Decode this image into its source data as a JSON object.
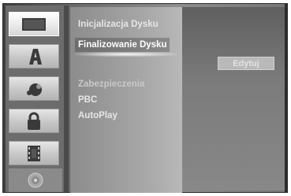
{
  "sidebar": {
    "icons": [
      {
        "name": "disc-tray-icon",
        "active": true
      },
      {
        "name": "letter-a-icon",
        "active": false
      },
      {
        "name": "audio-settings-icon",
        "active": false
      },
      {
        "name": "lock-icon",
        "active": false
      },
      {
        "name": "film-icon",
        "active": false
      },
      {
        "name": "disc-icon",
        "active": false
      }
    ]
  },
  "menu": {
    "items": [
      {
        "label": "Inicjalizacja Dysku",
        "state": "normal"
      },
      {
        "label": "Finalizowanie Dysku",
        "state": "selected"
      },
      {
        "label": "Zabezpieczenia",
        "state": "dim"
      },
      {
        "label": "PBC",
        "state": "normal"
      },
      {
        "label": "AutoPlay",
        "state": "normal"
      }
    ]
  },
  "action": {
    "edit_label": "Edytuj"
  },
  "colors": {
    "accent": "#ffffff",
    "panel": "#a9a9a9",
    "background": "#6f6f6f"
  }
}
